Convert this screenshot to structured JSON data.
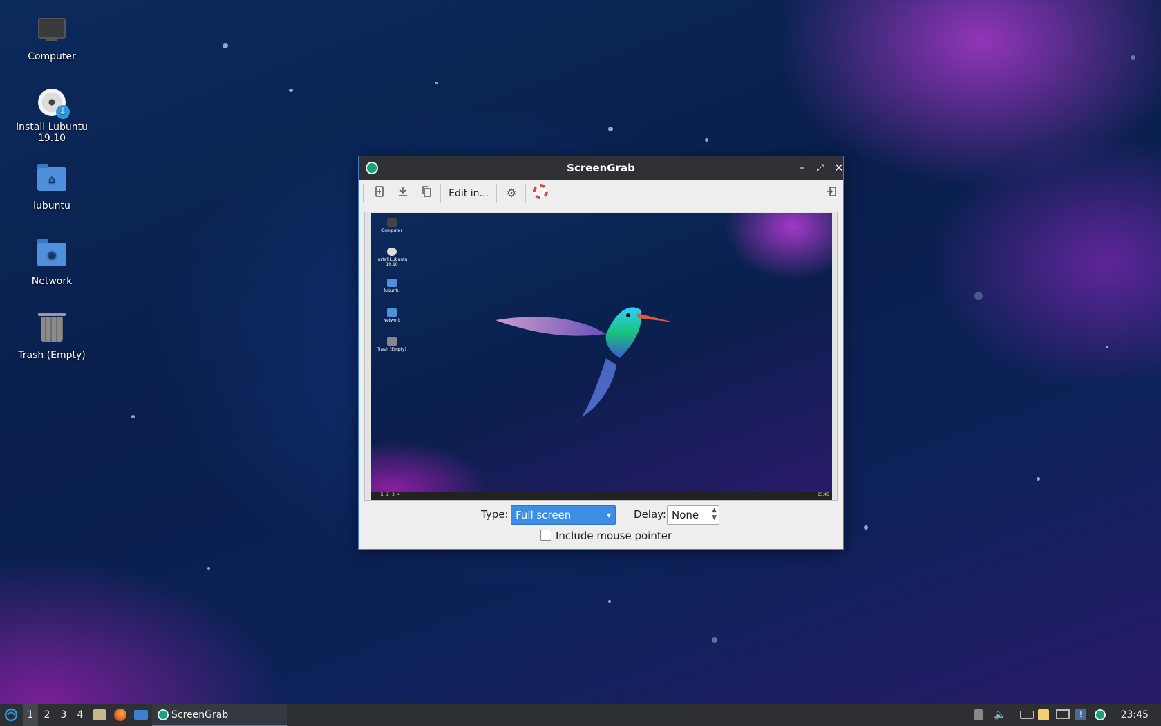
{
  "desktop": {
    "icons": [
      {
        "label": "Computer",
        "icon": "computer-icon"
      },
      {
        "label": "Install Lubuntu\n19.10",
        "icon": "install-disc-icon"
      },
      {
        "label": "lubuntu",
        "icon": "home-folder-icon"
      },
      {
        "label": "Network",
        "icon": "network-folder-icon"
      },
      {
        "label": "Trash (Empty)",
        "icon": "trash-icon"
      }
    ]
  },
  "window": {
    "title": "ScreenGrab",
    "toolbar": {
      "new_icon": "new-screenshot-icon",
      "save_icon": "save-icon",
      "copy_icon": "copy-icon",
      "edit_label": "Edit in...",
      "settings_icon": "gear-icon",
      "help_icon": "help-lifebuoy-icon",
      "quit_icon": "quit-icon"
    },
    "preview": {
      "mini_icons": [
        "Computer",
        "Install Lubuntu\n19.10",
        "lubuntu",
        "Network",
        "Trash (Empty)"
      ],
      "mini_workspaces": [
        "1",
        "2",
        "3",
        "4"
      ],
      "mini_clock": "23:45"
    },
    "controls": {
      "type_label": "Type:",
      "type_value": "Full screen",
      "delay_label": "Delay:",
      "delay_value": "None",
      "mouse_pointer_label": "Include mouse pointer",
      "mouse_pointer_checked": false
    }
  },
  "taskbar": {
    "workspaces": [
      "1",
      "2",
      "3",
      "4"
    ],
    "active_workspace": "1",
    "task_label": "ScreenGrab",
    "clock": "23:45"
  }
}
